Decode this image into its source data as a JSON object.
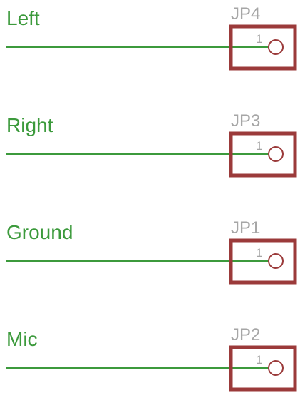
{
  "colors": {
    "wire": "#3c9a3c",
    "net_label": "#3c9a3c",
    "part_outline": "#9b3a3a",
    "ref_label": "#a6a6a6",
    "pin_label": "#a6a6a6",
    "background": "#ffffff"
  },
  "connectors": [
    {
      "net": "Left",
      "ref": "JP4",
      "pin": "1"
    },
    {
      "net": "Right",
      "ref": "JP3",
      "pin": "1"
    },
    {
      "net": "Ground",
      "ref": "JP1",
      "pin": "1"
    },
    {
      "net": "Mic",
      "ref": "JP2",
      "pin": "1"
    }
  ]
}
